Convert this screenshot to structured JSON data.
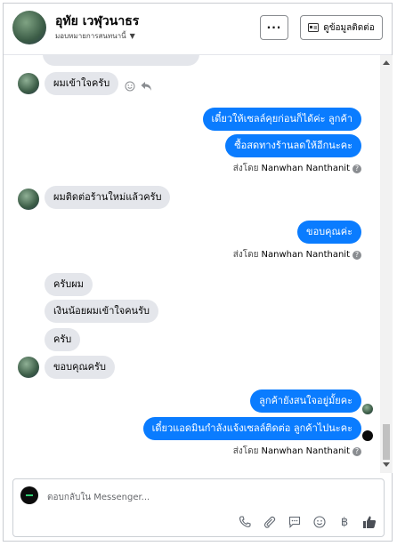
{
  "header": {
    "title": "อุทัย เวฬุวนาธร",
    "subtitle": "มอบหมายการสนทนานี้",
    "more_label": "···",
    "contact_label": "ดูข้อมูลติดต่อ"
  },
  "messages": {
    "m1": "ผมเข้าใจครับ",
    "m2": "เดี๋ยวให้เซลล์คุยก่อนก็ได้ค่ะ ลูกค้า",
    "m3": "ซื้อสดทางร้านลดให้อีกนะคะ",
    "sent1_prefix": "ส่งโดย",
    "sent1_name": "Nanwhan Nanthanit",
    "m4": "ผมติดต่อร้านใหม่แล้วครับ",
    "m5": "ขอบคุณค่ะ",
    "sent2_prefix": "ส่งโดย",
    "sent2_name": "Nanwhan Nanthanit",
    "m6": "ครับผม",
    "m7": "เงินน้อยผมเข้าใจคนรับ",
    "m8": "ครับ",
    "m9": "ขอบคุณครับ",
    "m10": "ลูกค้ายังสนใจอยู่มั้ยคะ",
    "m11": "เดี๋ยวแอดมินกำลังแจ้งเซลล์ติดต่อ ลูกค้าไปนะคะ",
    "sent3_prefix": "ส่งโดย",
    "sent3_name": "Nanwhan Nanthanit"
  },
  "composer": {
    "placeholder": "ตอบกลับใน Messenger..."
  },
  "icons": {
    "tools": [
      "phone-icon",
      "paperclip-icon",
      "quick-reply-icon",
      "emoji-icon",
      "baht-icon",
      "thumbs-up-icon"
    ]
  },
  "colors": {
    "outgoing": "#0a7cff",
    "incoming": "#e4e6eb"
  }
}
